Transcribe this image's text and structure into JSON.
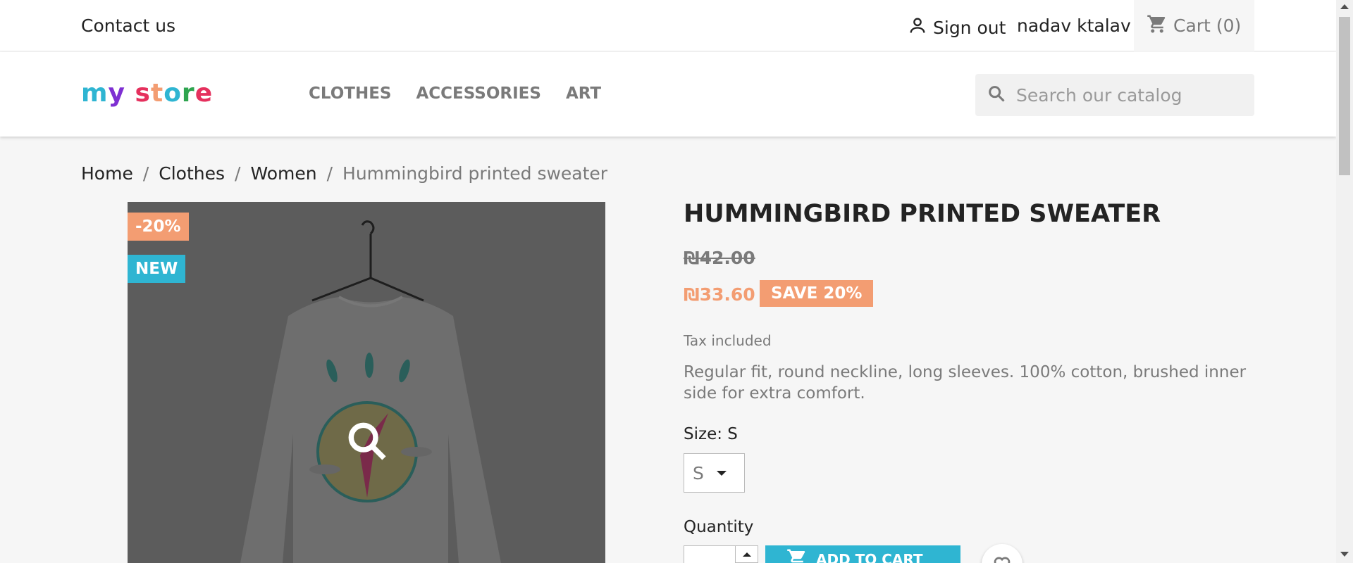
{
  "topbar": {
    "contact": "Contact us",
    "signout": "Sign out",
    "username": "nadav ktalav",
    "cart_label": "Cart",
    "cart_count": "(0)"
  },
  "header": {
    "logo_text": "my store",
    "nav": [
      "CLOTHES",
      "ACCESSORIES",
      "ART"
    ],
    "search_placeholder": "Search our catalog"
  },
  "breadcrumb": [
    "Home",
    "Clothes",
    "Women",
    "Hummingbird printed sweater"
  ],
  "product": {
    "discount_badge": "-20%",
    "new_badge": "NEW",
    "title": "HUMMINGBIRD PRINTED SWEATER",
    "old_price": "₪42.00",
    "price": "₪33.60",
    "save_label": "SAVE 20%",
    "tax": "Tax included",
    "description": "Regular fit, round neckline, long sleeves. 100% cotton, brushed inner side for extra comfort.",
    "size_label": "Size: S",
    "size_value": "S",
    "quantity_label": "Quantity",
    "add_to_cart": "ADD TO CART"
  },
  "colors": {
    "accent": "#2fb5d2",
    "discount": "#f39d72"
  }
}
